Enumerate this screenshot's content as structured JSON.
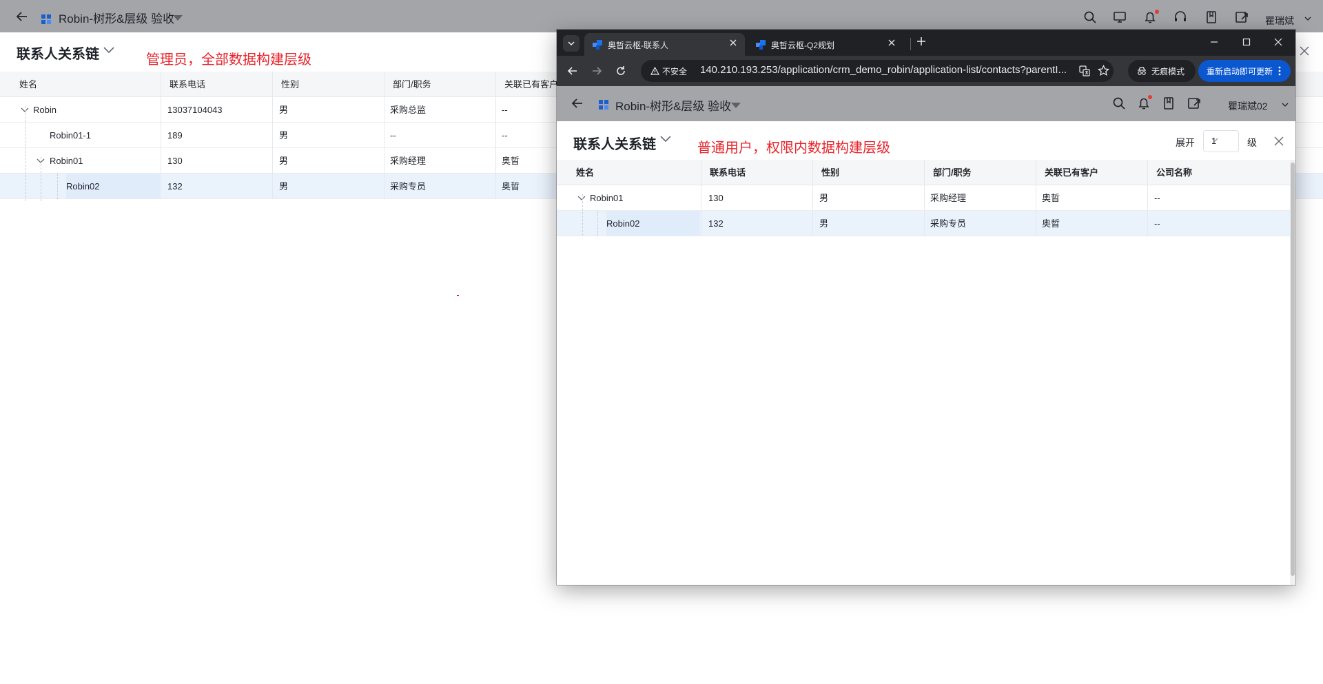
{
  "background_app": {
    "title": "Robin-树形&层级 验收",
    "user": "瞿瑞斌",
    "page_title": "联系人关系链",
    "annotation": "管理员，全部数据构建层级",
    "table": {
      "columns": [
        "姓名",
        "联系电话",
        "性别",
        "部门/职务",
        "关联已有客户"
      ],
      "rows": [
        {
          "name": "Robin",
          "phone": "13037104043",
          "gender": "男",
          "dept": "采购总监",
          "customer": "--"
        },
        {
          "name": "Robin01-1",
          "phone": "189",
          "gender": "男",
          "dept": "--",
          "customer": "--"
        },
        {
          "name": "Robin01",
          "phone": "130",
          "gender": "男",
          "dept": "采购经理",
          "customer": "奥晢"
        },
        {
          "name": "Robin02",
          "phone": "132",
          "gender": "男",
          "dept": "采购专员",
          "customer": "奥晢"
        }
      ]
    }
  },
  "browser": {
    "tabs": [
      {
        "title": "奥晢云枢-联系人",
        "active": true
      },
      {
        "title": "奥晢云枢-Q2规划",
        "active": false
      }
    ],
    "security_label": "不安全",
    "url": "140.210.193.253/application/crm_demo_robin/application-list/contacts?parentI...",
    "incognito_label": "无痕模式",
    "update_label": "重新启动即可更新"
  },
  "inner_app": {
    "title": "Robin-树形&层级 验收",
    "user": "瞿瑞斌02",
    "page_title": "联系人关系链",
    "annotation": "普通用户，权限内数据构建层级",
    "expand_label": "展开",
    "expand_level": "1",
    "level_suffix": "级",
    "table": {
      "columns": [
        "姓名",
        "联系电话",
        "性别",
        "部门/职务",
        "关联已有客户",
        "公司名称"
      ],
      "rows": [
        {
          "name": "Robin01",
          "phone": "130",
          "gender": "男",
          "dept": "采购经理",
          "customer": "奥晢",
          "company": "--"
        },
        {
          "name": "Robin02",
          "phone": "132",
          "gender": "男",
          "dept": "采购专员",
          "customer": "奥晢",
          "company": "--"
        }
      ]
    }
  },
  "colors": {
    "accent": "#0b57d0",
    "annotation": "#e8242b",
    "selected_row": "#eaf2fc"
  }
}
